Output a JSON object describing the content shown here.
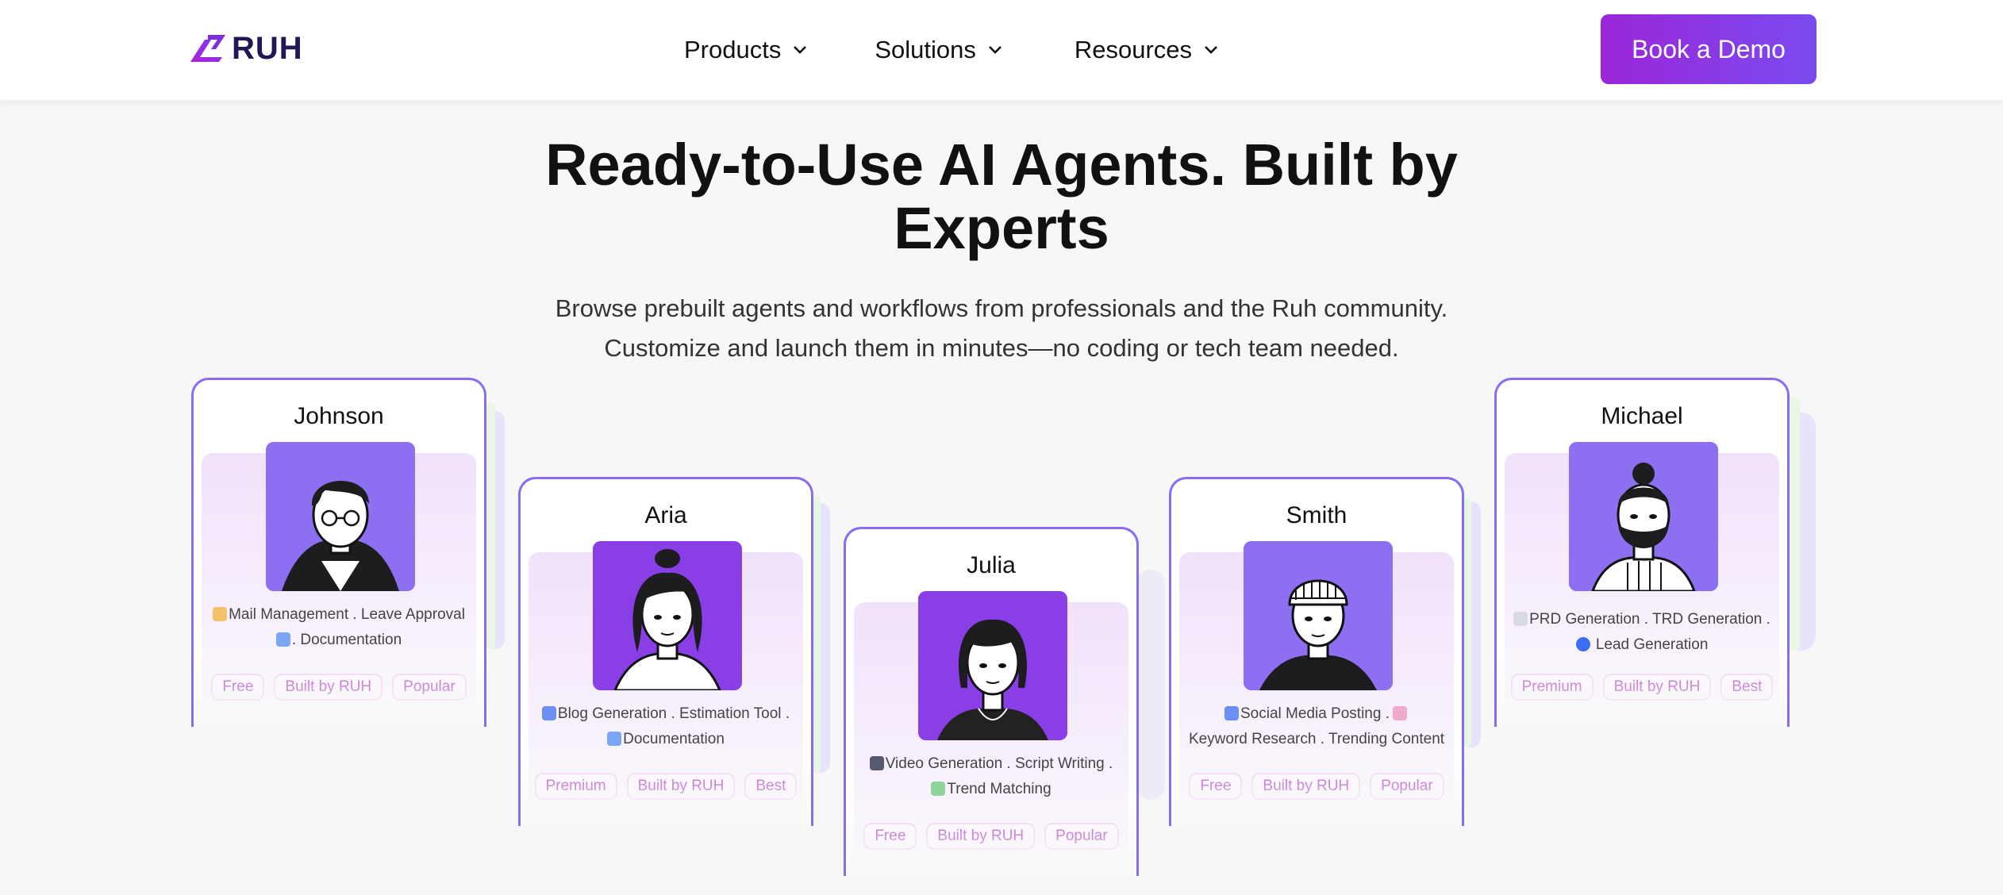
{
  "nav": {
    "brand": "RUH",
    "items": [
      {
        "label": "Products"
      },
      {
        "label": "Solutions"
      },
      {
        "label": "Resources"
      }
    ],
    "cta_label": "Book a Demo"
  },
  "hero": {
    "title_line1": "Ready-to-Use AI Agents. Built by",
    "title_line2": "Experts",
    "sub_line1": "Browse prebuilt agents and workflows from professionals and the Ruh community.",
    "sub_line2": "Customize and launch them in minutes—no coding or tech team needed."
  },
  "cards": [
    {
      "name": "Johnson",
      "skills_line1": "Mail Management . Leave Approval",
      "skills_line2": ". Documentation",
      "tags": [
        "Free",
        "Built by RUH",
        "Popular"
      ]
    },
    {
      "name": "Aria",
      "skills_line1": "Blog Generation . Estimation Tool .",
      "skills_line2": "Documentation",
      "tags": [
        "Premium",
        "Built by RUH",
        "Best"
      ]
    },
    {
      "name": "Julia",
      "skills_line1": "Video Generation . Script Writing .",
      "skills_line2": "Trend Matching",
      "tags": [
        "Free",
        "Built by RUH",
        "Popular"
      ]
    },
    {
      "name": "Smith",
      "skills_line1": "Social Media Posting .",
      "skills_line2": "Keyword Research . Trending Content",
      "tags": [
        "Free",
        "Built by RUH",
        "Popular"
      ]
    },
    {
      "name": "Michael",
      "skills_line1": "PRD Generation . TRD Generation .",
      "skills_line2": "Lead Generation",
      "tags": [
        "Premium",
        "Built by RUH",
        "Best"
      ]
    }
  ],
  "colors": {
    "brand_purple": "#9b26d8",
    "cta_end": "#7a4bf0",
    "card_border": "#8b6bf0",
    "tag_text": "#b24cc6"
  }
}
